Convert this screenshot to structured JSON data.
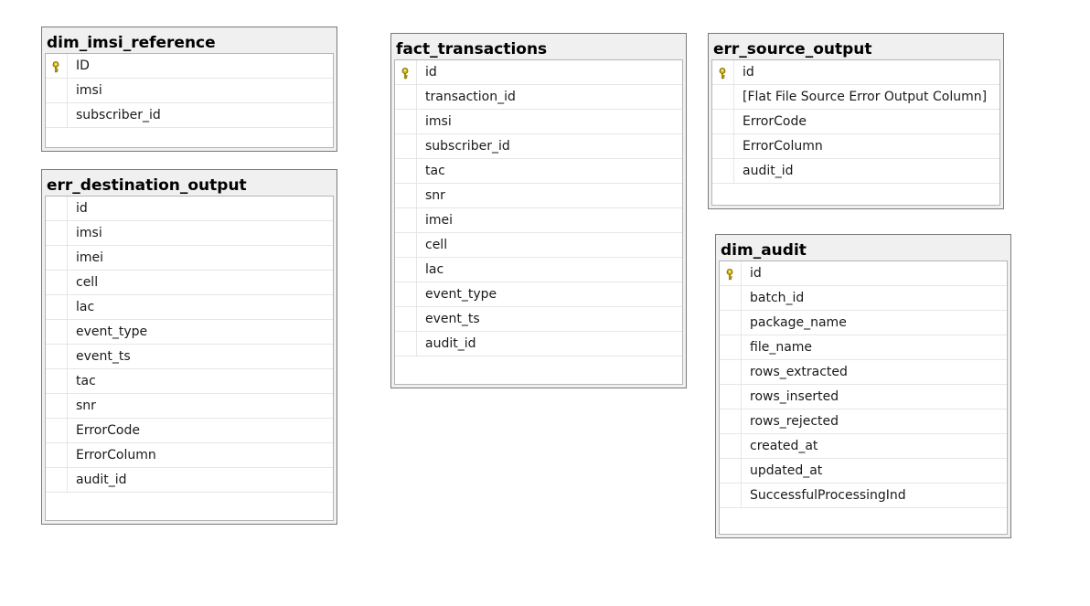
{
  "tables": {
    "dim_imsi_reference": {
      "title": "dim_imsi_reference",
      "columns": [
        {
          "name": "ID",
          "pk": true
        },
        {
          "name": "imsi",
          "pk": false
        },
        {
          "name": "subscriber_id",
          "pk": false
        }
      ]
    },
    "err_destination_output": {
      "title": "err_destination_output",
      "columns": [
        {
          "name": "id",
          "pk": false
        },
        {
          "name": "imsi",
          "pk": false
        },
        {
          "name": "imei",
          "pk": false
        },
        {
          "name": "cell",
          "pk": false
        },
        {
          "name": "lac",
          "pk": false
        },
        {
          "name": "event_type",
          "pk": false
        },
        {
          "name": "event_ts",
          "pk": false
        },
        {
          "name": "tac",
          "pk": false
        },
        {
          "name": "snr",
          "pk": false
        },
        {
          "name": "ErrorCode",
          "pk": false
        },
        {
          "name": "ErrorColumn",
          "pk": false
        },
        {
          "name": "audit_id",
          "pk": false
        }
      ]
    },
    "fact_transactions": {
      "title": "fact_transactions",
      "columns": [
        {
          "name": "id",
          "pk": true
        },
        {
          "name": "transaction_id",
          "pk": false
        },
        {
          "name": "imsi",
          "pk": false
        },
        {
          "name": "subscriber_id",
          "pk": false
        },
        {
          "name": "tac",
          "pk": false
        },
        {
          "name": "snr",
          "pk": false
        },
        {
          "name": "imei",
          "pk": false
        },
        {
          "name": "cell",
          "pk": false
        },
        {
          "name": "lac",
          "pk": false
        },
        {
          "name": "event_type",
          "pk": false
        },
        {
          "name": "event_ts",
          "pk": false
        },
        {
          "name": "audit_id",
          "pk": false
        }
      ]
    },
    "err_source_output": {
      "title": "err_source_output",
      "columns": [
        {
          "name": "id",
          "pk": true
        },
        {
          "name": "[Flat File Source Error Output Column]",
          "pk": false
        },
        {
          "name": "ErrorCode",
          "pk": false
        },
        {
          "name": "ErrorColumn",
          "pk": false
        },
        {
          "name": "audit_id",
          "pk": false
        }
      ]
    },
    "dim_audit": {
      "title": "dim_audit",
      "columns": [
        {
          "name": "id",
          "pk": true
        },
        {
          "name": "batch_id",
          "pk": false
        },
        {
          "name": "package_name",
          "pk": false
        },
        {
          "name": "file_name",
          "pk": false
        },
        {
          "name": "rows_extracted",
          "pk": false
        },
        {
          "name": "rows_inserted",
          "pk": false
        },
        {
          "name": "rows_rejected",
          "pk": false
        },
        {
          "name": "created_at",
          "pk": false
        },
        {
          "name": "updated_at",
          "pk": false
        },
        {
          "name": "SuccessfulProcessingInd",
          "pk": false
        }
      ]
    }
  },
  "icons": {
    "primary_key": "key-icon",
    "key_color": "#d6b800"
  }
}
